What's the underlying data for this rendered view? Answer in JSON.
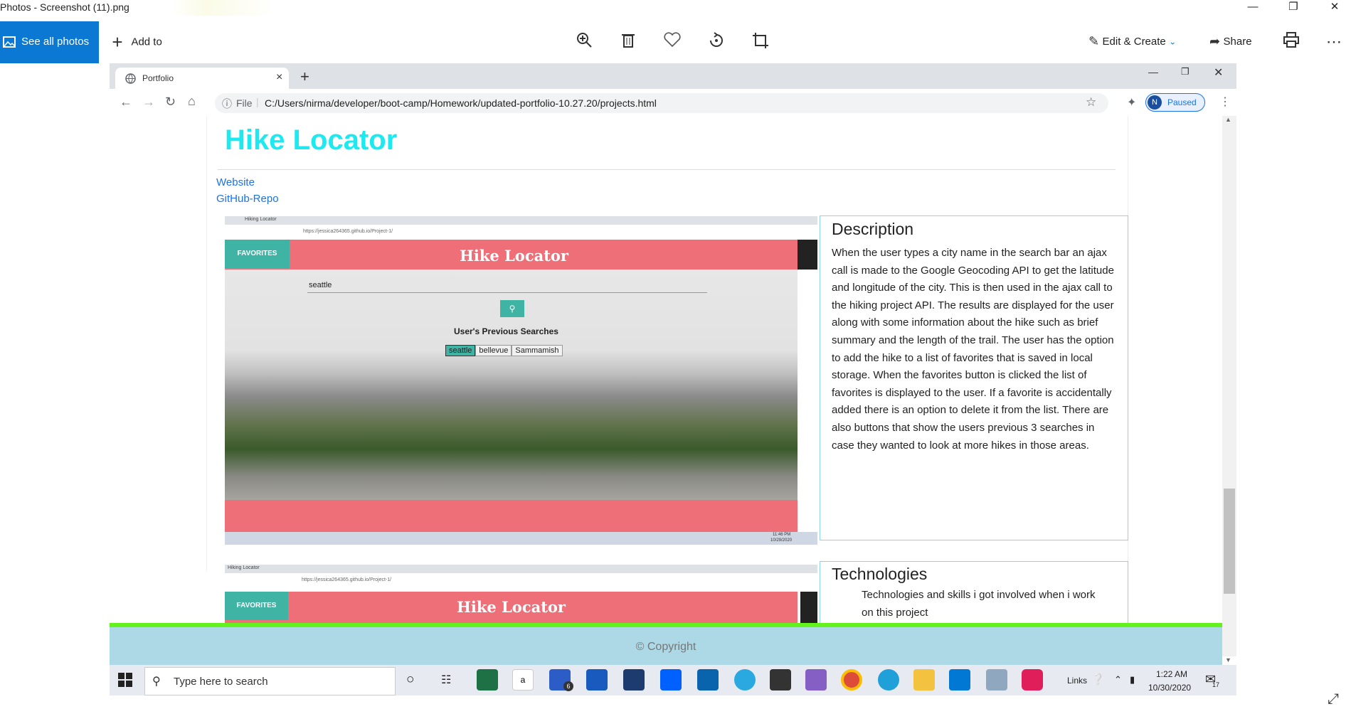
{
  "photos_app": {
    "title": "Photos - Screenshot (11).png",
    "see_all_photos": "See all photos",
    "add_to": "Add to",
    "edit_create": "Edit & Create",
    "share": "Share"
  },
  "browser": {
    "tab_title": "Portfolio",
    "url_scheme": "File",
    "url": "C:/Users/nirma/developer/boot-camp/Homework/updated-portfolio-10.27.20/projects.html",
    "profile_initial": "N",
    "profile_status": "Paused"
  },
  "project": {
    "title": "Hike Locator",
    "links": [
      "Website",
      "GitHub-Repo"
    ],
    "screenshot1": {
      "tab": "Hiking Locator",
      "url": "https://jessica264365.github.io/Project-1/",
      "fav_button": "FAVORITES",
      "header": "Hike Locator",
      "search_value": "seattle",
      "prev_title": "User's Previous Searches",
      "prev_searches": [
        "seattle",
        "bellevue",
        "Sammamish"
      ],
      "clock": "11:46 PM",
      "date": "10/29/2020"
    },
    "screenshot2": {
      "tab": "Hiking Locator",
      "url": "https://jessica264365.github.io/Project-1/",
      "fav_button": "FAVORITES",
      "header": "Hike Locator"
    },
    "description": {
      "heading": "Description",
      "text": "When the user types a city name in the search bar an ajax call is made to the Google Geocoding API to get the latitude and longitude of the city. This is then used in the ajax call to the hiking project API. The results are displayed for the user along with some information about the hike such as brief summary and the length of the trail. The user has the option to add the hike to a list of favorites that is saved in local storage. When the favorites button is clicked the list of favorites is displayed to the user. If a favorite is accidentally added there is an option to delete it from the list. There are also buttons that show the users previous 3 searches in case they wanted to look at more hikes in those areas."
    },
    "technologies": {
      "heading": "Technologies",
      "text": "Technologies and skills i got involved when i work on this project"
    }
  },
  "footer": {
    "copyright": "© Copyright"
  },
  "taskbar": {
    "search_placeholder": "Type here to search",
    "links": "Links",
    "time": "1:22 AM",
    "date": "10/30/2020",
    "mail_badge": "6",
    "notif_count": "17"
  },
  "colors": {
    "title_cyan": "#1de9f0",
    "photos_blue": "#0b78d4",
    "pink_header": "#ef6f78",
    "teal_button": "#3fb3a4",
    "footer_blue": "#add8e6",
    "footer_line": "#64f21f"
  }
}
